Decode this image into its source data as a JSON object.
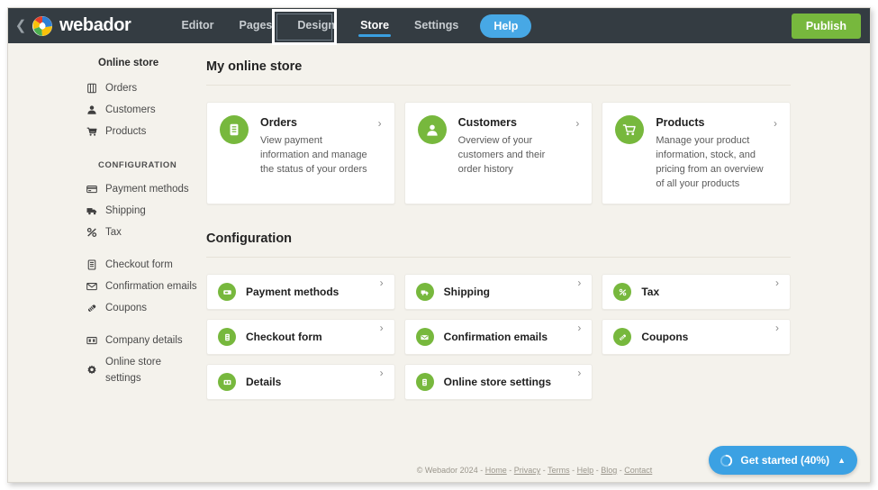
{
  "topbar": {
    "back_icon": "chevron-left-icon",
    "logo_icon": "webador-logo-icon",
    "brand": "webador",
    "nav": [
      {
        "label": "Editor",
        "active": false
      },
      {
        "label": "Pages",
        "active": false
      },
      {
        "label": "Design",
        "active": false
      },
      {
        "label": "Store",
        "active": true
      },
      {
        "label": "Settings",
        "active": false
      }
    ],
    "help_label": "Help",
    "publish_label": "Publish",
    "highlight_target": "Store",
    "accent_blue": "#3a9fe0",
    "publish_green": "#77b83d",
    "bar_color": "#343c42"
  },
  "sidebar": {
    "heading": "Online store",
    "primary_items": [
      {
        "label": "Orders",
        "icon": "orders-icon"
      },
      {
        "label": "Customers",
        "icon": "customers-icon"
      },
      {
        "label": "Products",
        "icon": "products-cart-icon"
      }
    ],
    "config_heading": "CONFIGURATION",
    "config_items": [
      {
        "label": "Payment methods",
        "icon": "credit-card-icon"
      },
      {
        "label": "Shipping",
        "icon": "truck-icon"
      },
      {
        "label": "Tax",
        "icon": "percent-icon"
      }
    ],
    "second_items": [
      {
        "label": "Checkout form",
        "icon": "form-icon"
      },
      {
        "label": "Confirmation emails",
        "icon": "envelope-icon"
      },
      {
        "label": "Coupons",
        "icon": "coupon-icon"
      }
    ],
    "third_items": [
      {
        "label": "Company details",
        "icon": "building-icon"
      },
      {
        "label": "Online store settings",
        "icon": "gear-icon"
      }
    ]
  },
  "main": {
    "title": "My online store",
    "cards": [
      {
        "title": "Orders",
        "desc": "View payment information and manage the status of your orders",
        "icon": "orders-icon"
      },
      {
        "title": "Customers",
        "desc": "Overview of your customers and their order history",
        "icon": "customers-icon"
      },
      {
        "title": "Products",
        "desc": "Manage your product information, stock, and pricing from an overview of all your products",
        "icon": "products-cart-icon"
      }
    ],
    "config_title": "Configuration",
    "config_cards": [
      {
        "label": "Payment methods",
        "icon": "credit-card-icon"
      },
      {
        "label": "Shipping",
        "icon": "truck-icon"
      },
      {
        "label": "Tax",
        "icon": "percent-icon"
      },
      {
        "label": "Checkout form",
        "icon": "form-icon"
      },
      {
        "label": "Confirmation emails",
        "icon": "envelope-icon"
      },
      {
        "label": "Coupons",
        "icon": "coupon-icon"
      },
      {
        "label": "Details",
        "icon": "building-icon"
      },
      {
        "label": "Online store settings",
        "icon": "gear-icon"
      },
      {
        "label": "",
        "icon": ""
      }
    ],
    "chevron": "›",
    "icon_green": "#77b83d"
  },
  "footer": {
    "copyright": "© Webador 2024 -",
    "links": [
      "Home",
      "Privacy",
      "Terms",
      "Help",
      "Blog",
      "Contact"
    ],
    "separator": "-"
  },
  "getstarted": {
    "label": "Get started (40%)",
    "progress": 40,
    "caret": "▲",
    "color": "#3ba1e3"
  }
}
